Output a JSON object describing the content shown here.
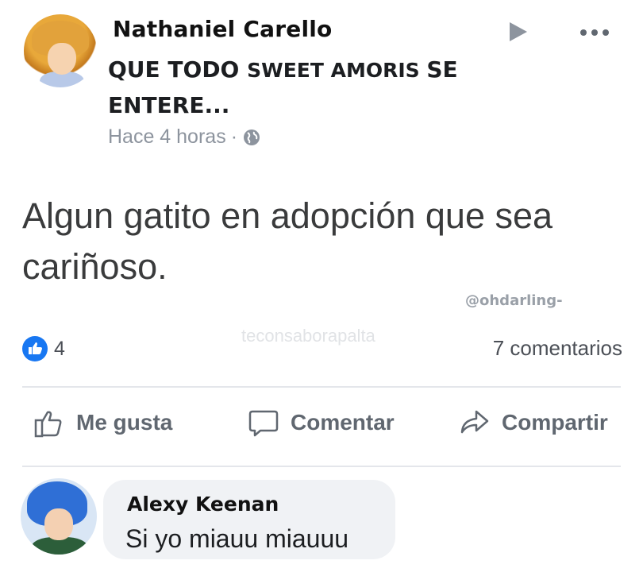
{
  "post": {
    "author": "Nathaniel Carello",
    "headline_part1": "QUE TODO ",
    "headline_part2": "SWEET AMORIS ",
    "headline_part3": " SE ENTERE...",
    "time": "Hace 4 horas",
    "separator": "·",
    "message": "Algun gatito en adopción que sea cariñoso.",
    "watermark_handle": "@ohdarling-",
    "watermark_faint": "teconsaborapalta"
  },
  "stats": {
    "likes": "4",
    "comments": "7 comentarios"
  },
  "actions": {
    "like": "Me gusta",
    "comment": "Comentar",
    "share": "Compartir"
  },
  "comment": {
    "author": "Alexy Keenan",
    "text": "Si yo miauu miauuu"
  },
  "colors": {
    "like_blue": "#1877f2",
    "meta_gray": "#8d949e",
    "bubble_bg": "#f0f2f5"
  },
  "icons": [
    "globe-icon",
    "play-icon",
    "more-icon",
    "like-badge-icon",
    "thumbs-up-icon",
    "comment-icon",
    "share-icon"
  ]
}
